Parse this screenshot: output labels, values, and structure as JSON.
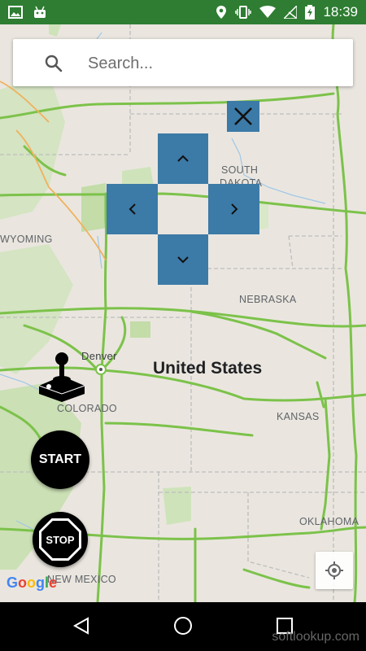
{
  "status_bar": {
    "time": "18:39"
  },
  "search": {
    "placeholder": "Search..."
  },
  "map": {
    "labels": {
      "south_dakota_1": "SOUTH",
      "south_dakota_2": "DAKOTA",
      "wyoming": "WYOMING",
      "nebraska": "NEBRASKA",
      "denver": "Denver",
      "united_states": "United States",
      "colorado": "COLORADO",
      "kansas": "KANSAS",
      "oklahoma": "OKLAHOMA",
      "new_mexico": "NEW MEXICO"
    },
    "google_logo": "Google"
  },
  "controls": {
    "start_label": "START",
    "stop_label": "STOP"
  },
  "watermark": "softlookup.com",
  "colors": {
    "status_bar": "#2e7d32",
    "dpad": "#3c7aa7",
    "highway": "#7cc24a",
    "land": "#eae6df",
    "forest": "#c8e0b0"
  }
}
